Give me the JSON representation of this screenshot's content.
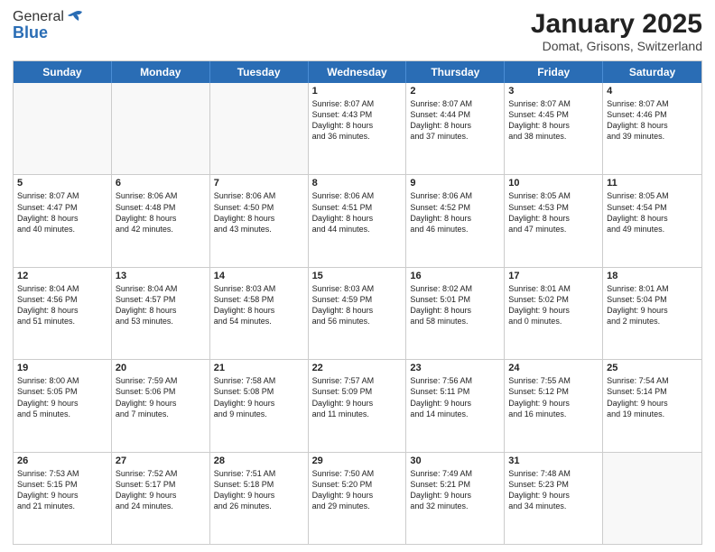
{
  "header": {
    "logo_general": "General",
    "logo_blue": "Blue",
    "month_title": "January 2025",
    "location": "Domat, Grisons, Switzerland"
  },
  "days_of_week": [
    "Sunday",
    "Monday",
    "Tuesday",
    "Wednesday",
    "Thursday",
    "Friday",
    "Saturday"
  ],
  "weeks": [
    [
      {
        "day": "",
        "empty": true
      },
      {
        "day": "",
        "empty": true
      },
      {
        "day": "",
        "empty": true
      },
      {
        "day": "1",
        "lines": [
          "Sunrise: 8:07 AM",
          "Sunset: 4:43 PM",
          "Daylight: 8 hours",
          "and 36 minutes."
        ]
      },
      {
        "day": "2",
        "lines": [
          "Sunrise: 8:07 AM",
          "Sunset: 4:44 PM",
          "Daylight: 8 hours",
          "and 37 minutes."
        ]
      },
      {
        "day": "3",
        "lines": [
          "Sunrise: 8:07 AM",
          "Sunset: 4:45 PM",
          "Daylight: 8 hours",
          "and 38 minutes."
        ]
      },
      {
        "day": "4",
        "lines": [
          "Sunrise: 8:07 AM",
          "Sunset: 4:46 PM",
          "Daylight: 8 hours",
          "and 39 minutes."
        ]
      }
    ],
    [
      {
        "day": "5",
        "lines": [
          "Sunrise: 8:07 AM",
          "Sunset: 4:47 PM",
          "Daylight: 8 hours",
          "and 40 minutes."
        ]
      },
      {
        "day": "6",
        "lines": [
          "Sunrise: 8:06 AM",
          "Sunset: 4:48 PM",
          "Daylight: 8 hours",
          "and 42 minutes."
        ]
      },
      {
        "day": "7",
        "lines": [
          "Sunrise: 8:06 AM",
          "Sunset: 4:50 PM",
          "Daylight: 8 hours",
          "and 43 minutes."
        ]
      },
      {
        "day": "8",
        "lines": [
          "Sunrise: 8:06 AM",
          "Sunset: 4:51 PM",
          "Daylight: 8 hours",
          "and 44 minutes."
        ]
      },
      {
        "day": "9",
        "lines": [
          "Sunrise: 8:06 AM",
          "Sunset: 4:52 PM",
          "Daylight: 8 hours",
          "and 46 minutes."
        ]
      },
      {
        "day": "10",
        "lines": [
          "Sunrise: 8:05 AM",
          "Sunset: 4:53 PM",
          "Daylight: 8 hours",
          "and 47 minutes."
        ]
      },
      {
        "day": "11",
        "lines": [
          "Sunrise: 8:05 AM",
          "Sunset: 4:54 PM",
          "Daylight: 8 hours",
          "and 49 minutes."
        ]
      }
    ],
    [
      {
        "day": "12",
        "lines": [
          "Sunrise: 8:04 AM",
          "Sunset: 4:56 PM",
          "Daylight: 8 hours",
          "and 51 minutes."
        ]
      },
      {
        "day": "13",
        "lines": [
          "Sunrise: 8:04 AM",
          "Sunset: 4:57 PM",
          "Daylight: 8 hours",
          "and 53 minutes."
        ]
      },
      {
        "day": "14",
        "lines": [
          "Sunrise: 8:03 AM",
          "Sunset: 4:58 PM",
          "Daylight: 8 hours",
          "and 54 minutes."
        ]
      },
      {
        "day": "15",
        "lines": [
          "Sunrise: 8:03 AM",
          "Sunset: 4:59 PM",
          "Daylight: 8 hours",
          "and 56 minutes."
        ]
      },
      {
        "day": "16",
        "lines": [
          "Sunrise: 8:02 AM",
          "Sunset: 5:01 PM",
          "Daylight: 8 hours",
          "and 58 minutes."
        ]
      },
      {
        "day": "17",
        "lines": [
          "Sunrise: 8:01 AM",
          "Sunset: 5:02 PM",
          "Daylight: 9 hours",
          "and 0 minutes."
        ]
      },
      {
        "day": "18",
        "lines": [
          "Sunrise: 8:01 AM",
          "Sunset: 5:04 PM",
          "Daylight: 9 hours",
          "and 2 minutes."
        ]
      }
    ],
    [
      {
        "day": "19",
        "lines": [
          "Sunrise: 8:00 AM",
          "Sunset: 5:05 PM",
          "Daylight: 9 hours",
          "and 5 minutes."
        ]
      },
      {
        "day": "20",
        "lines": [
          "Sunrise: 7:59 AM",
          "Sunset: 5:06 PM",
          "Daylight: 9 hours",
          "and 7 minutes."
        ]
      },
      {
        "day": "21",
        "lines": [
          "Sunrise: 7:58 AM",
          "Sunset: 5:08 PM",
          "Daylight: 9 hours",
          "and 9 minutes."
        ]
      },
      {
        "day": "22",
        "lines": [
          "Sunrise: 7:57 AM",
          "Sunset: 5:09 PM",
          "Daylight: 9 hours",
          "and 11 minutes."
        ]
      },
      {
        "day": "23",
        "lines": [
          "Sunrise: 7:56 AM",
          "Sunset: 5:11 PM",
          "Daylight: 9 hours",
          "and 14 minutes."
        ]
      },
      {
        "day": "24",
        "lines": [
          "Sunrise: 7:55 AM",
          "Sunset: 5:12 PM",
          "Daylight: 9 hours",
          "and 16 minutes."
        ]
      },
      {
        "day": "25",
        "lines": [
          "Sunrise: 7:54 AM",
          "Sunset: 5:14 PM",
          "Daylight: 9 hours",
          "and 19 minutes."
        ]
      }
    ],
    [
      {
        "day": "26",
        "lines": [
          "Sunrise: 7:53 AM",
          "Sunset: 5:15 PM",
          "Daylight: 9 hours",
          "and 21 minutes."
        ]
      },
      {
        "day": "27",
        "lines": [
          "Sunrise: 7:52 AM",
          "Sunset: 5:17 PM",
          "Daylight: 9 hours",
          "and 24 minutes."
        ]
      },
      {
        "day": "28",
        "lines": [
          "Sunrise: 7:51 AM",
          "Sunset: 5:18 PM",
          "Daylight: 9 hours",
          "and 26 minutes."
        ]
      },
      {
        "day": "29",
        "lines": [
          "Sunrise: 7:50 AM",
          "Sunset: 5:20 PM",
          "Daylight: 9 hours",
          "and 29 minutes."
        ]
      },
      {
        "day": "30",
        "lines": [
          "Sunrise: 7:49 AM",
          "Sunset: 5:21 PM",
          "Daylight: 9 hours",
          "and 32 minutes."
        ]
      },
      {
        "day": "31",
        "lines": [
          "Sunrise: 7:48 AM",
          "Sunset: 5:23 PM",
          "Daylight: 9 hours",
          "and 34 minutes."
        ]
      },
      {
        "day": "",
        "empty": true
      }
    ]
  ]
}
